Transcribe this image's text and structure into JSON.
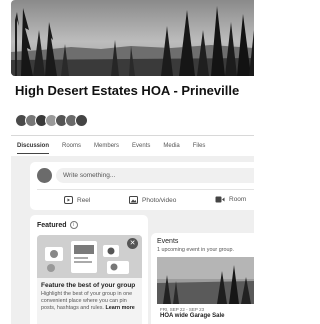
{
  "group": {
    "name": "High Desert Estates HOA - Prineville",
    "member_avatar_count": 7
  },
  "tabs": [
    {
      "label": "Discussion",
      "active": true
    },
    {
      "label": "Rooms",
      "active": false
    },
    {
      "label": "Members",
      "active": false
    },
    {
      "label": "Events",
      "active": false
    },
    {
      "label": "Media",
      "active": false
    },
    {
      "label": "Files",
      "active": false
    }
  ],
  "composer": {
    "placeholder": "Write something...",
    "actions": {
      "reel": "Reel",
      "photo": "Photo/video",
      "room": "Room"
    }
  },
  "featured": {
    "header": "Featured",
    "info_icon": "info-icon",
    "card_title": "Feature the best of your group",
    "card_desc": "Highlight the best of your group in one convenient place where you can pin posts, hashtags and rules.",
    "learn_more": "Learn more",
    "close_icon": "close-icon"
  },
  "events": {
    "title": "Events",
    "subtitle": "1 upcoming event in your group.",
    "event_date": "FRI, SEP 22 - SEP 23",
    "event_name": "HOA wide Garage Sale"
  }
}
